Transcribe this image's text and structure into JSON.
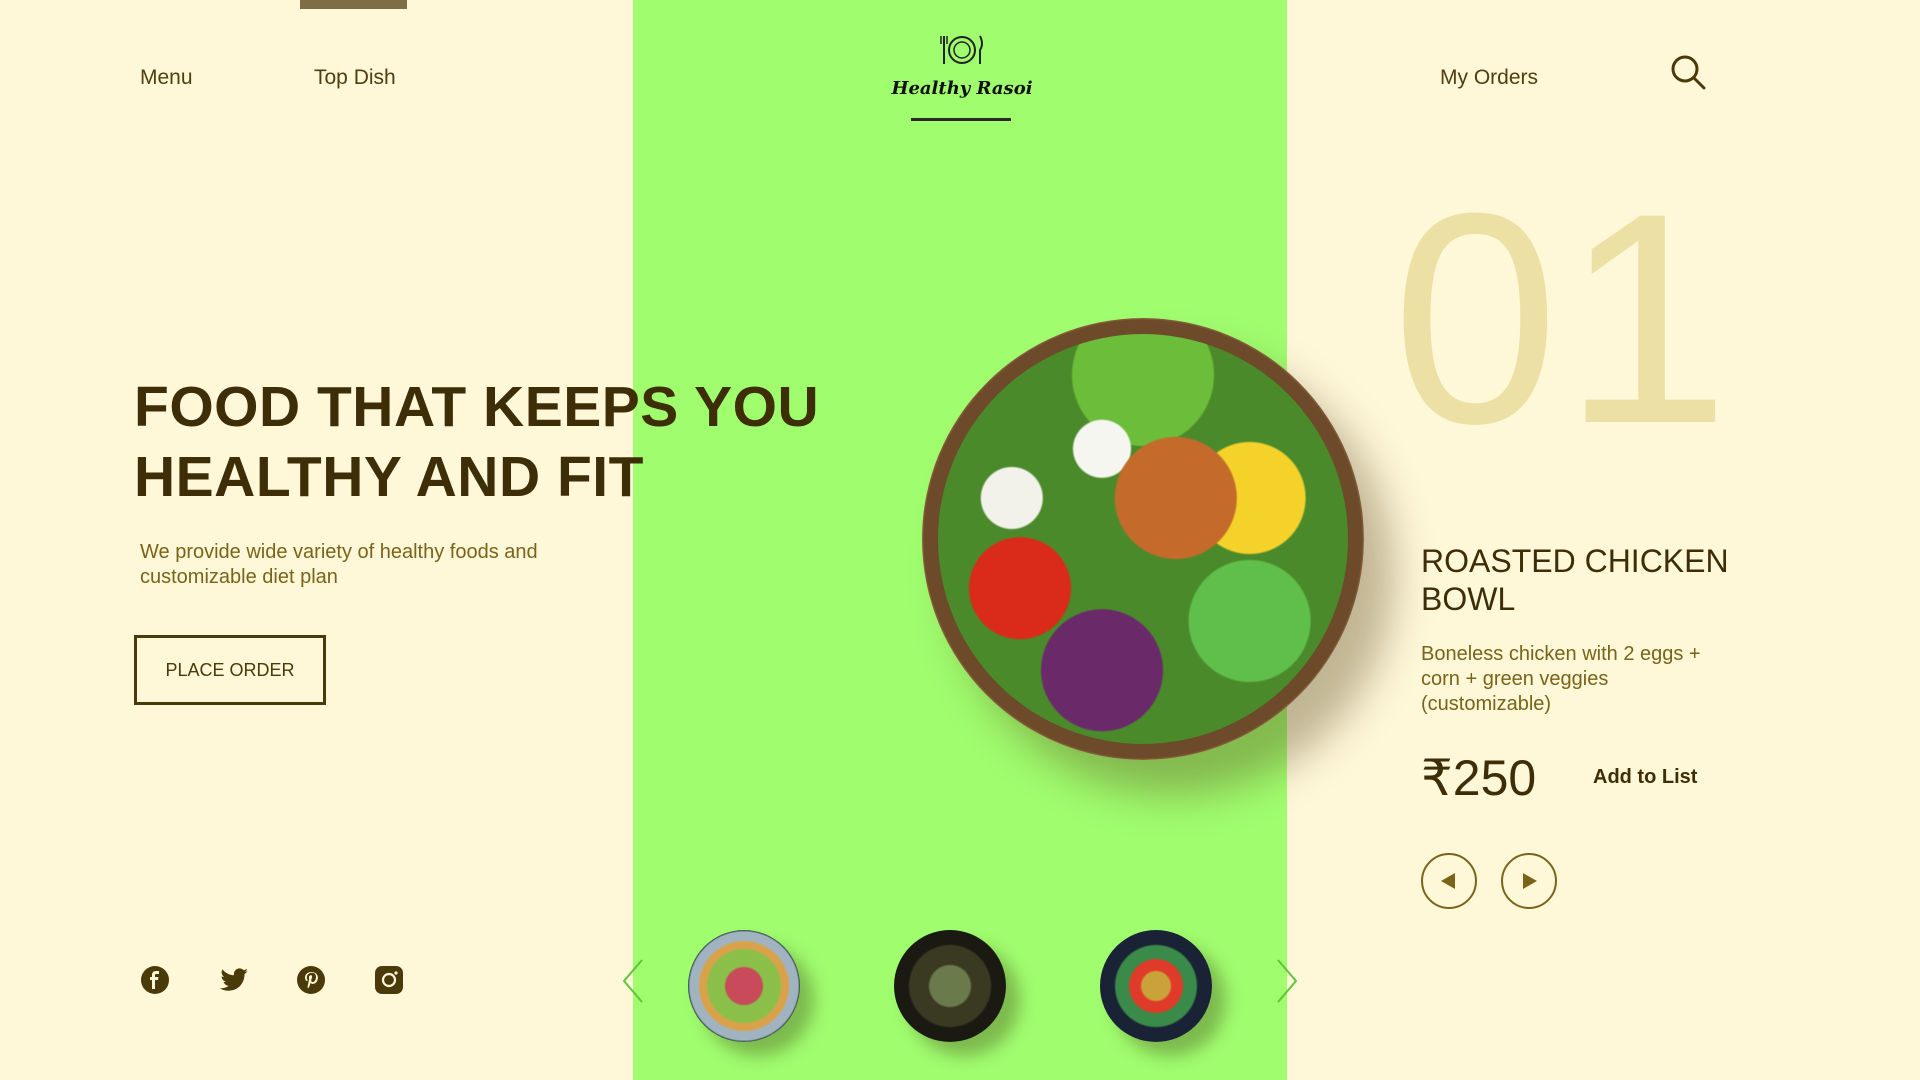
{
  "nav": {
    "menu_label": "Menu",
    "top_dish_label": "Top Dish",
    "my_orders_label": "My Orders",
    "search_icon": "search-icon"
  },
  "brand": {
    "name": "Healthy Rasoi",
    "logo_icon": "plate-fork-knife-icon"
  },
  "hero": {
    "headline_line1": "FOOD THAT KEEPS YOU",
    "headline_line2": "HEALTHY AND FIT",
    "subtext": "We provide wide variety of healthy foods and customizable diet plan",
    "cta_label": "PLACE ORDER"
  },
  "socials": [
    {
      "icon": "facebook-icon"
    },
    {
      "icon": "twitter-icon"
    },
    {
      "icon": "pinterest-icon"
    },
    {
      "icon": "instagram-icon"
    }
  ],
  "featured": {
    "number": "01",
    "title": "ROASTED CHICKEN BOWL",
    "description": "Boneless chicken with 2 eggs + corn + green veggies (customizable)",
    "price": "₹250",
    "add_label": "Add to List",
    "prev_icon": "triangle-left-icon",
    "next_icon": "triangle-right-icon"
  },
  "carousel": {
    "prev_icon": "chevron-left-icon",
    "next_icon": "chevron-right-icon",
    "thumbnails": [
      {
        "name": "salad-bowl-thumbnail"
      },
      {
        "name": "noodle-bowl-thumbnail"
      },
      {
        "name": "veggie-bowl-thumbnail"
      }
    ]
  },
  "colors": {
    "background": "#fef7d8",
    "accent_green": "#a0fd6e",
    "dark_brown": "#3e2e08",
    "muted_gold": "#7a6419",
    "number_tint": "#ede0a4"
  }
}
